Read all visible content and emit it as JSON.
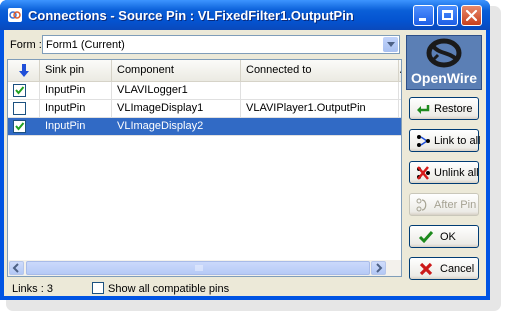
{
  "window": {
    "title": "Connections - Source Pin : VLFixedFilter1.OutputPin"
  },
  "form_row": {
    "label": "Form :",
    "selected": "Form1  (Current)"
  },
  "grid": {
    "columns": [
      "Sink pin",
      "Component",
      "Connected to",
      "A"
    ],
    "rows": [
      {
        "checked": true,
        "sink_pin": "InputPin",
        "component": "VLAVILogger1",
        "connected_to": ""
      },
      {
        "checked": false,
        "sink_pin": "InputPin",
        "component": "VLImageDisplay1",
        "connected_to": "VLAVIPlayer1.OutputPin"
      },
      {
        "checked": true,
        "sink_pin": "InputPin",
        "component": "VLImageDisplay2",
        "connected_to": "",
        "selected": true
      }
    ]
  },
  "status": {
    "links": "Links : 3",
    "show_all_label": "Show all compatible pins"
  },
  "logo": {
    "text": "OpenWire"
  },
  "buttons": {
    "restore": "Restore",
    "link_all": "Link to all",
    "unlink_all": "Unlink all",
    "after_pin": "After Pin",
    "ok": "OK",
    "cancel": "Cancel"
  },
  "colors": {
    "title_bar": "#0453d0",
    "selection": "#316ac5",
    "face": "#ece9d8"
  }
}
